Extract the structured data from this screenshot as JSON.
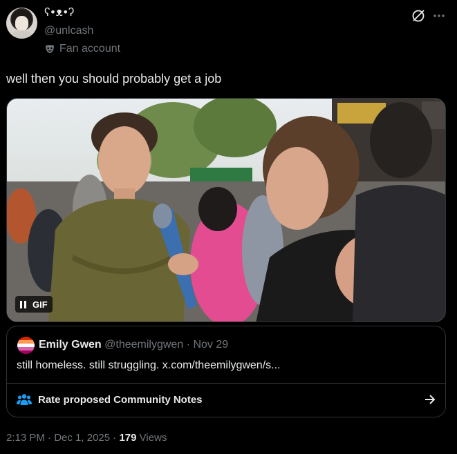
{
  "author": {
    "display_name": "ʕ•ᴥ•ʔ",
    "handle": "@unlcash",
    "label": "Fan account",
    "avatar_icon": "user-avatar",
    "label_icon": "mask-icon"
  },
  "header_icons": [
    "grok-icon",
    "more-icon"
  ],
  "tweet": {
    "text": "well then you should probably get a job"
  },
  "media": {
    "type": "GIF",
    "badge_label": "GIF",
    "badge_icon": "pause-icon"
  },
  "quote": {
    "name": "Emily Gwen",
    "handle": "@theemilygwen",
    "separator": " · ",
    "date": "Nov 29",
    "text": "still homeless. still struggling. x.com/theemilygwen/s...",
    "notes_label": "Rate proposed Community Notes",
    "notes_icon": "community-people-icon",
    "arrow_icon": "arrow-right-icon"
  },
  "footer": {
    "time": "2:13 PM",
    "separator": " · ",
    "date": "Dec 1, 2025",
    "views_count": "179",
    "views_label": "Views"
  },
  "colors": {
    "background": "#000000",
    "text": "#e7e9ea",
    "muted": "#71767b",
    "border": "#2f3336",
    "accent": "#1d9bf0"
  }
}
